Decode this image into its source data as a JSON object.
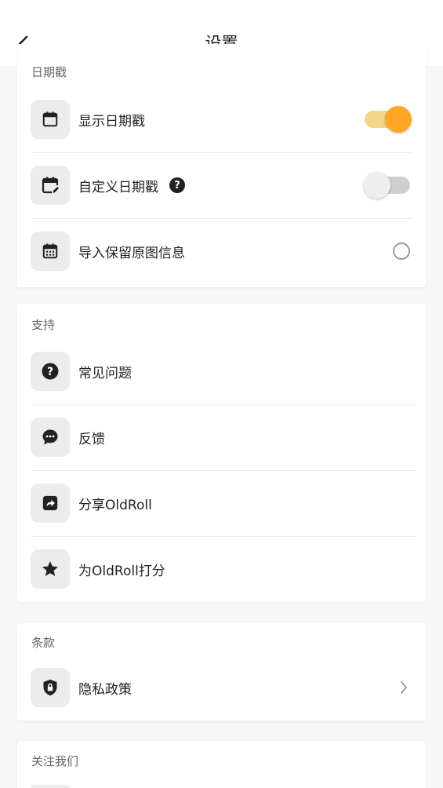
{
  "colors": {
    "accent": "#FFA726",
    "accent_track": "#F6D58A",
    "off_track": "#CFCFCF",
    "off_knob": "#EEEEEE",
    "status_dot": "#6EDCB0"
  },
  "header": {
    "title": "设置",
    "back_icon": "chevron-left-icon"
  },
  "sections": {
    "date_stamp": {
      "label": "日期戳",
      "items": [
        {
          "label": "显示日期戳",
          "icon": "calendar-icon",
          "control": "toggle",
          "value": true
        },
        {
          "label": "自定义日期戳",
          "icon": "calendar-edit-icon",
          "control": "toggle",
          "value": false,
          "help": "?"
        },
        {
          "label": "导入保留原图信息",
          "icon": "calendar-grid-icon",
          "control": "radio",
          "value": false
        }
      ]
    },
    "support": {
      "label": "支持",
      "items": [
        {
          "label": "常见问题",
          "icon": "question-circle-icon"
        },
        {
          "label": "反馈",
          "icon": "chat-bubble-icon"
        },
        {
          "label": "分享OldRoll",
          "icon": "share-icon"
        },
        {
          "label": "为OldRoll打分",
          "icon": "star-icon"
        }
      ]
    },
    "terms": {
      "label": "条款",
      "items": [
        {
          "label": "隐私政策",
          "icon": "shield-lock-icon",
          "control": "chevron"
        }
      ]
    },
    "follow": {
      "label": "关注我们"
    }
  }
}
